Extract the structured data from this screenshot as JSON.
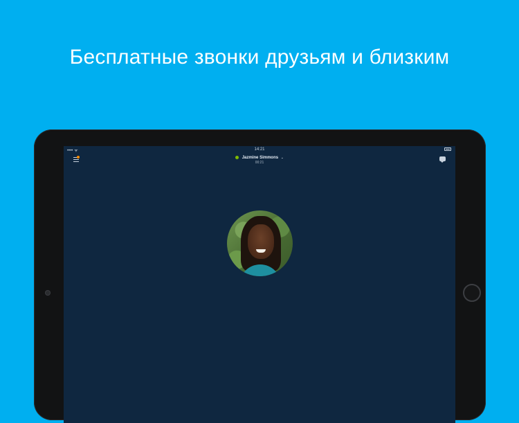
{
  "headline": "Бесплатные звонки друзьям и близким",
  "status_bar": {
    "carrier_signal": "•••• ᯤ",
    "time": "14:21"
  },
  "call": {
    "contact_name": "Jazmine Simmons",
    "chevron": "⌄",
    "duration": "00:21"
  },
  "icons": {
    "menu": "menu-icon",
    "chat": "chat-icon",
    "presence": "presence-dot-icon"
  },
  "colors": {
    "background": "#00aff0",
    "screen": "#0f2740",
    "presence": "#7fba00",
    "notification_dot": "#ff8c00"
  }
}
